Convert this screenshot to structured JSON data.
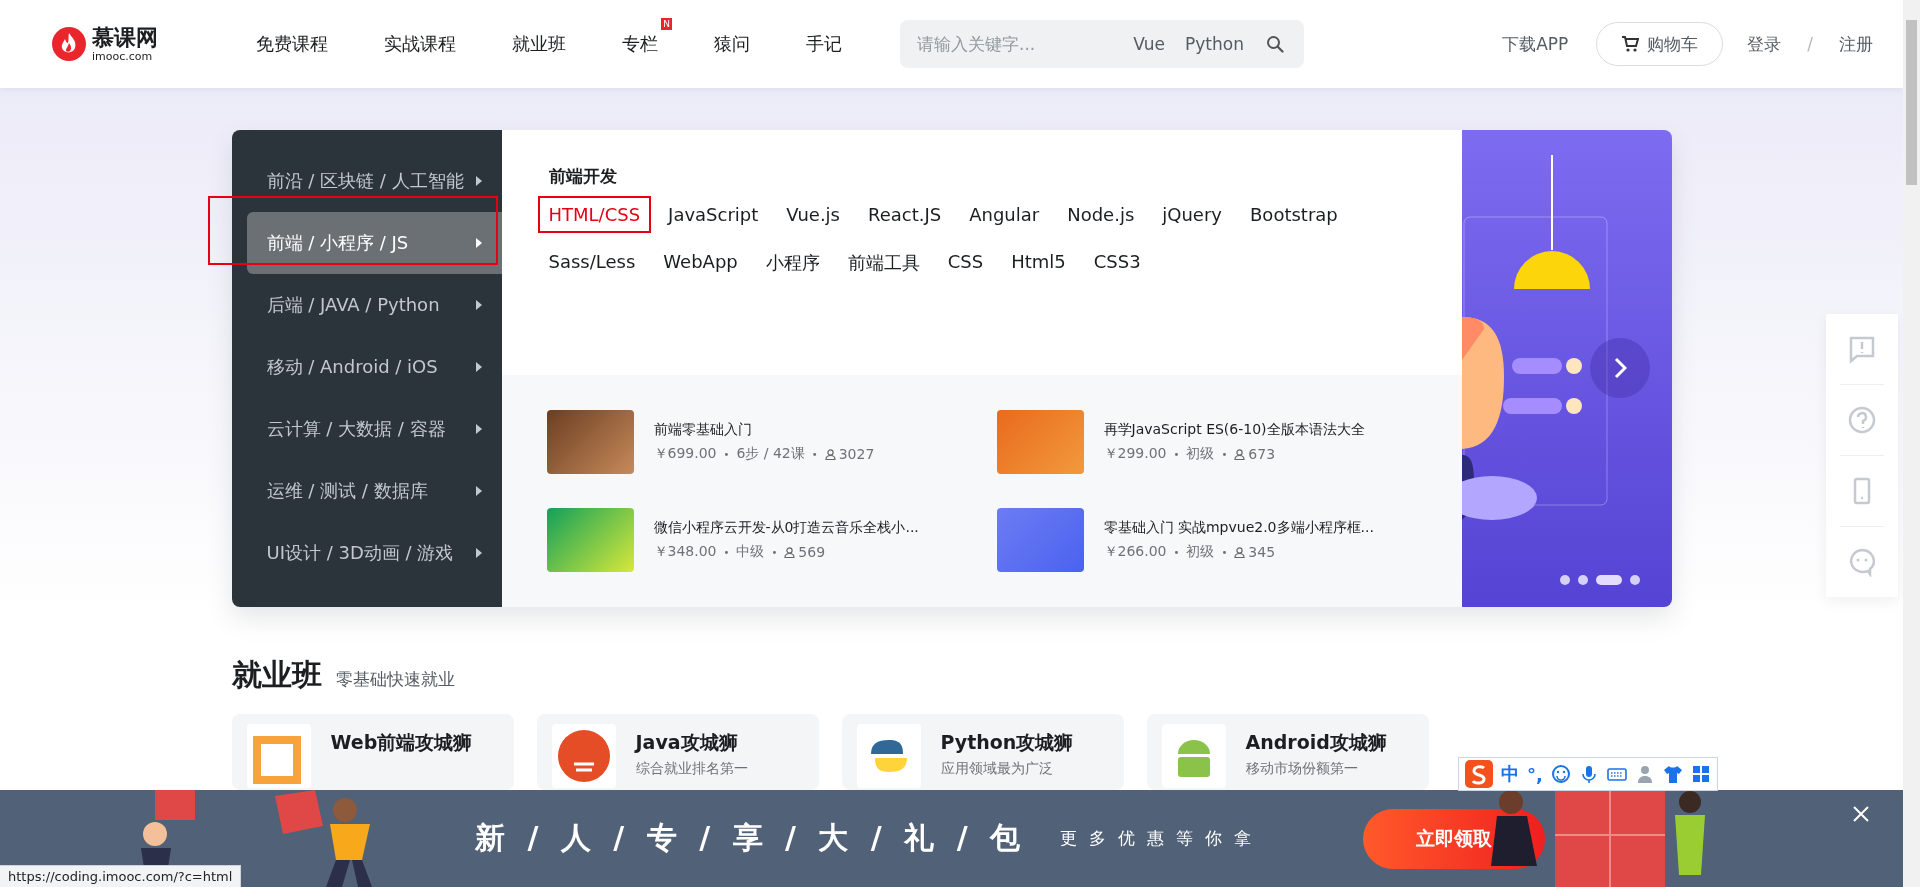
{
  "header": {
    "logo": {
      "name": "慕课网",
      "domain": "imooc.com"
    },
    "nav": [
      {
        "label": "免费课程"
      },
      {
        "label": "实战课程"
      },
      {
        "label": "就业班"
      },
      {
        "label": "专栏",
        "badge": "N"
      },
      {
        "label": "猿问"
      },
      {
        "label": "手记"
      }
    ],
    "search": {
      "placeholder": "请输入关键字...",
      "hot_words": [
        "Vue",
        "Python"
      ]
    },
    "download": "下载APP",
    "cart": "购物车",
    "login": "登录",
    "separator": "/",
    "register": "注册"
  },
  "categories": [
    {
      "label": "前沿 / 区块链 / 人工智能",
      "selected": false
    },
    {
      "label": "前端 / 小程序 / JS",
      "selected": true
    },
    {
      "label": "后端 / JAVA / Python",
      "selected": false
    },
    {
      "label": "移动 / Android / iOS",
      "selected": false
    },
    {
      "label": "云计算 / 大数据 / 容器",
      "selected": false
    },
    {
      "label": "运维 / 测试 / 数据库",
      "selected": false
    },
    {
      "label": "UI设计 / 3D动画 / 游戏",
      "selected": false
    }
  ],
  "subcategory": {
    "title": "前端开发",
    "tags": [
      {
        "label": "HTML/CSS",
        "selected": true
      },
      {
        "label": "JavaScript",
        "selected": false
      },
      {
        "label": "Vue.js",
        "selected": false
      },
      {
        "label": "React.JS",
        "selected": false
      },
      {
        "label": "Angular",
        "selected": false
      },
      {
        "label": "Node.js",
        "selected": false
      },
      {
        "label": "jQuery",
        "selected": false
      },
      {
        "label": "Bootstrap",
        "selected": false
      },
      {
        "label": "Sass/Less",
        "selected": false
      },
      {
        "label": "WebApp",
        "selected": false
      },
      {
        "label": "小程序",
        "selected": false
      },
      {
        "label": "前端工具",
        "selected": false
      },
      {
        "label": "CSS",
        "selected": false
      },
      {
        "label": "Html5",
        "selected": false
      },
      {
        "label": "CSS3",
        "selected": false
      }
    ]
  },
  "courses": [
    {
      "title": "前端零基础入门",
      "meta": [
        "￥699.00",
        "•",
        "6步 / 42课",
        "•"
      ],
      "students": "3027"
    },
    {
      "title": "再学JavaScript ES(6-10)全版本语法大全",
      "meta": [
        "￥299.00",
        "•",
        "初级",
        "•"
      ],
      "students": "673"
    },
    {
      "title": "微信小程序云开发-从0打造云音乐全栈小...",
      "meta": [
        "￥348.00",
        "•",
        "中级",
        "•"
      ],
      "students": "569"
    },
    {
      "title": "零基础入门 实战mpvue2.0多端小程序框...",
      "meta": [
        "￥266.00",
        "•",
        "初级",
        "•"
      ],
      "students": "345"
    }
  ],
  "carousel": {
    "dots": [
      {
        "selected": false
      },
      {
        "selected": false
      },
      {
        "selected": true
      },
      {
        "selected": false
      }
    ]
  },
  "section": {
    "title": "就业班",
    "subtitle": "零基础快速就业",
    "cards": [
      {
        "title": "Web前端攻城狮"
      },
      {
        "title": "Java攻城狮",
        "subtitle": "综合就业排名第一"
      },
      {
        "title": "Python攻城狮",
        "subtitle": "应用领域最为广泛"
      },
      {
        "title": "Android攻城狮",
        "subtitle": "移动市场份额第一"
      }
    ]
  },
  "promo": {
    "slogan": "新 / 人 / 专 / 享 / 大 / 礼 / 包",
    "subtitle": "更多优惠等你拿",
    "button": "立即领取"
  },
  "ime_toolbar": {
    "mode": "中",
    "punctuation": "°,"
  },
  "status_bar": {
    "url": "https://coding.imooc.com/?c=html"
  }
}
